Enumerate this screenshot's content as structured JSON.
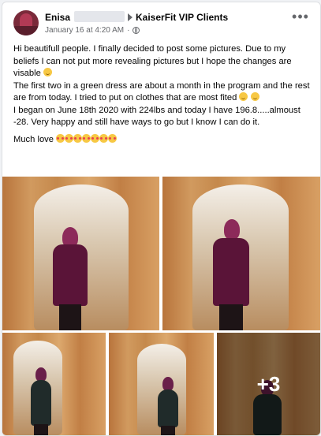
{
  "post": {
    "author": "Enisa",
    "group": "KaiserFit VIP Clients",
    "timestamp": "January 16 at 4:20 AM",
    "more_label": "•••",
    "paragraphs": [
      "Hi beautifull people. I finally decided to post some pictures. Due to my beliefs I can not put more revealing pictures but I hope the changes are visable",
      "The first two in a green dress are about a month in the program and the rest are from today. I tried to put on clothes that are most fited",
      "I began on June 18th 2020 with 224lbs and today I have 196.8.....almoust -28. Very happy and still have ways to go but I know I can do it.",
      "Much love"
    ],
    "icons": {
      "avatar": "profile-photo",
      "arrow": "right-triangle-icon",
      "privacy": "globe-icon",
      "emoji_smile": "smiling-face-emoji",
      "emoji_wink": "winking-face-emoji",
      "emoji_hearts": "smiling-face-with-hearts-emoji"
    },
    "more_photos_label": "+3"
  }
}
